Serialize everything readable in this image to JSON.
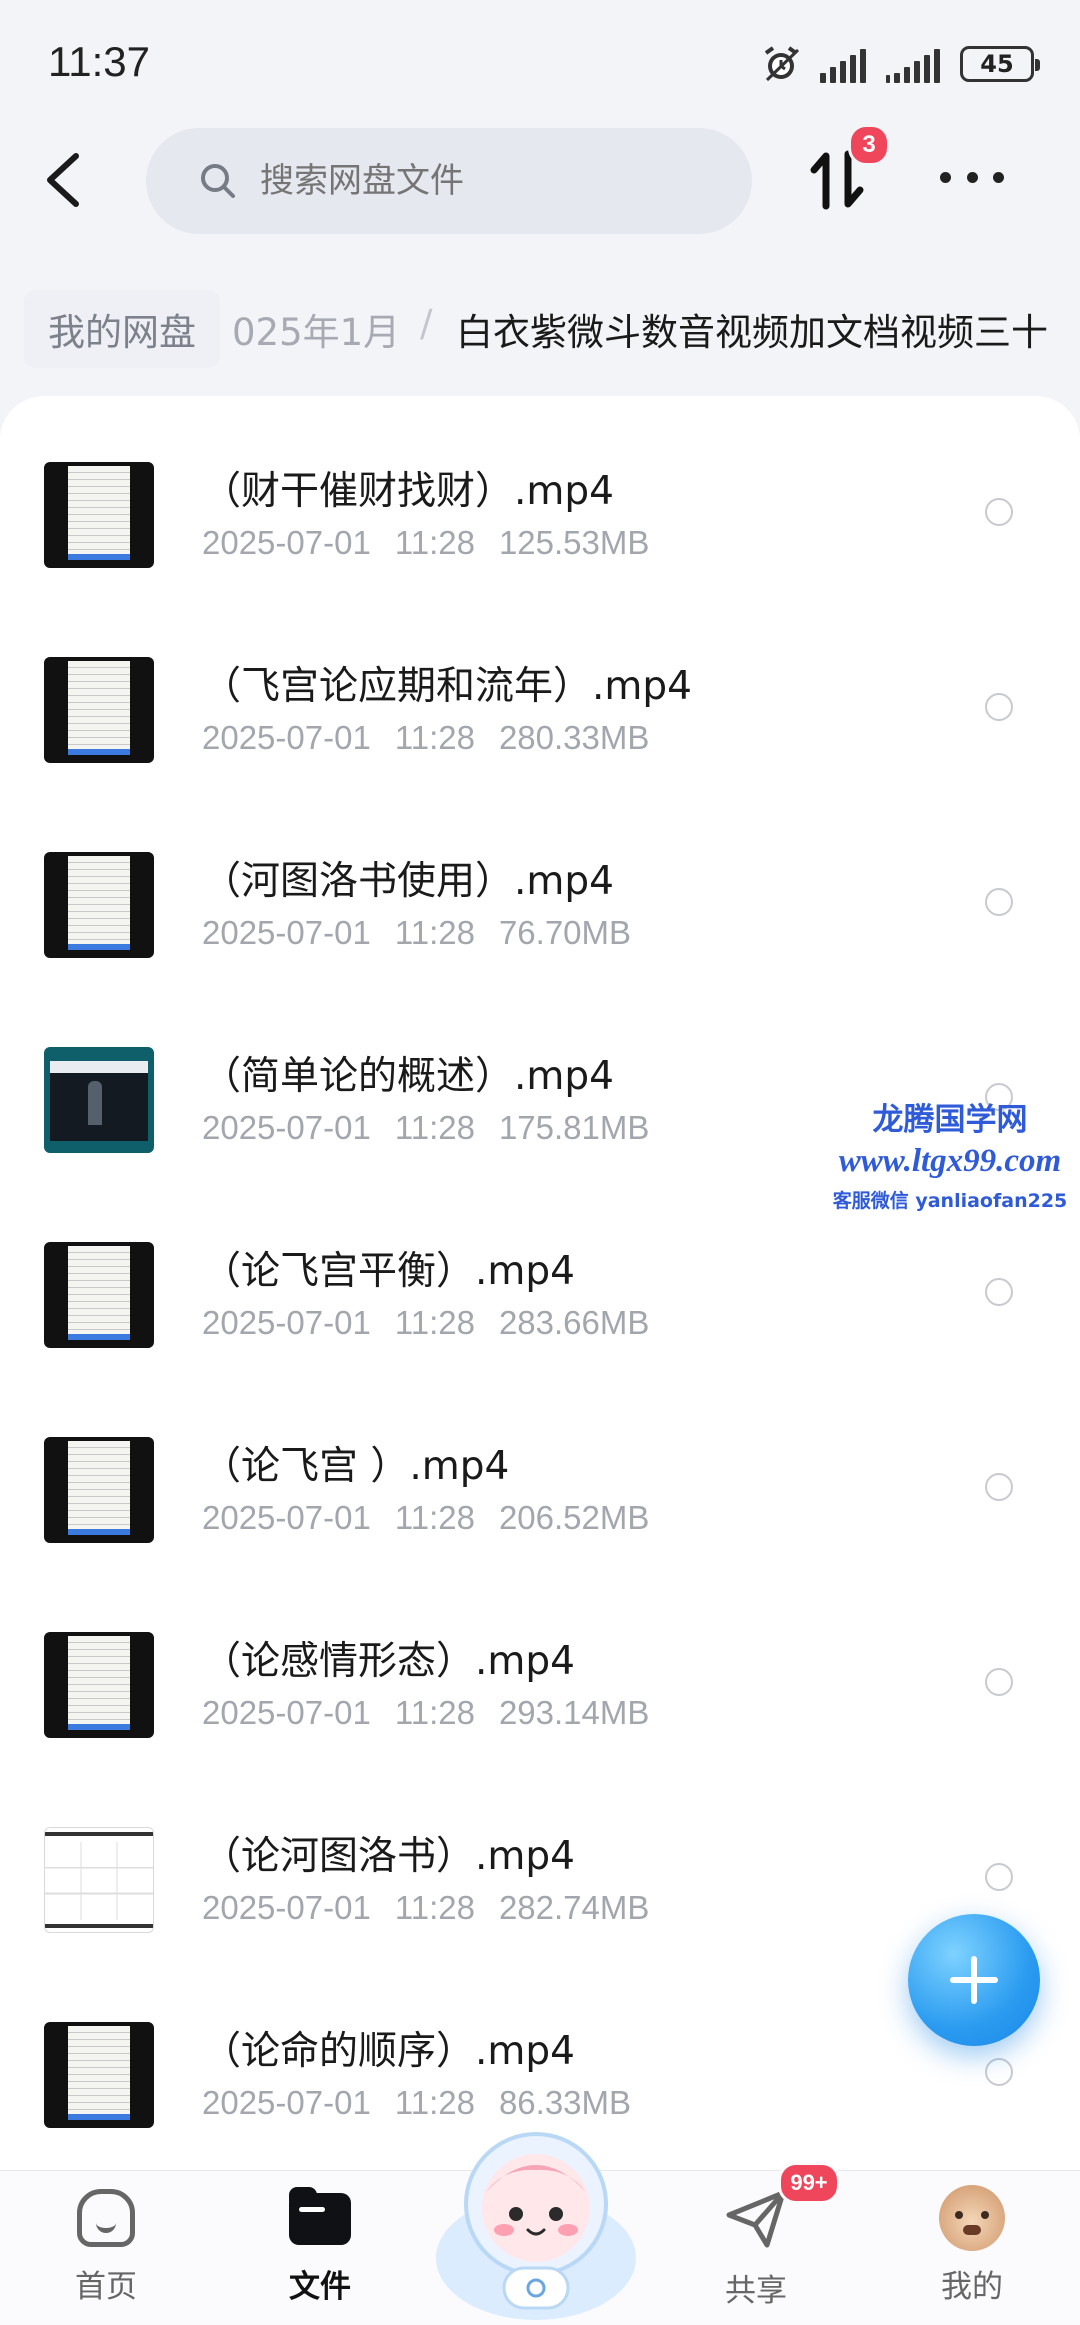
{
  "status_bar": {
    "time": "11:37",
    "battery": "45"
  },
  "header": {
    "search_placeholder": "搜索网盘文件",
    "transfer_badge": "3"
  },
  "breadcrumb": {
    "root": "我的网盘",
    "level2": "025年1月",
    "separator": "/",
    "current": "白衣紫微斗数音视频加文档视频三十"
  },
  "files": [
    {
      "name": "（财干催财找财）.mp4",
      "date": "2025-07-01",
      "time": "11:28",
      "size": "125.53MB",
      "thumb": "doc"
    },
    {
      "name": "（飞宫论应期和流年）.mp4",
      "date": "2025-07-01",
      "time": "11:28",
      "size": "280.33MB",
      "thumb": "doc"
    },
    {
      "name": "（河图洛书使用）.mp4",
      "date": "2025-07-01",
      "time": "11:28",
      "size": "76.70MB",
      "thumb": "doc"
    },
    {
      "name": "（简单论的概述）.mp4",
      "date": "2025-07-01",
      "time": "11:28",
      "size": "175.81MB",
      "thumb": "video"
    },
    {
      "name": "（论飞宫平衡）.mp4",
      "date": "2025-07-01",
      "time": "11:28",
      "size": "283.66MB",
      "thumb": "doc"
    },
    {
      "name": "（论飞宫 ）.mp4",
      "date": "2025-07-01",
      "time": "11:28",
      "size": "206.52MB",
      "thumb": "doc"
    },
    {
      "name": "（论感情形态）.mp4",
      "date": "2025-07-01",
      "time": "11:28",
      "size": "293.14MB",
      "thumb": "doc"
    },
    {
      "name": "（论河图洛书）.mp4",
      "date": "2025-07-01",
      "time": "11:28",
      "size": "282.74MB",
      "thumb": "white"
    },
    {
      "name": "（论命的顺序）.mp4",
      "date": "2025-07-01",
      "time": "11:28",
      "size": "86.33MB",
      "thumb": "doc"
    }
  ],
  "watermark": {
    "line1": "龙腾国学网",
    "line2": "www.ltgx99.com",
    "line3": "客服微信 yanliaofan225"
  },
  "bottom_nav": {
    "home": "首页",
    "files": "文件",
    "share": "共享",
    "share_badge": "99+",
    "me": "我的"
  },
  "colors": {
    "accent": "#2a9bf0",
    "badge": "#f0465b",
    "watermark": "#2f5bd8"
  }
}
